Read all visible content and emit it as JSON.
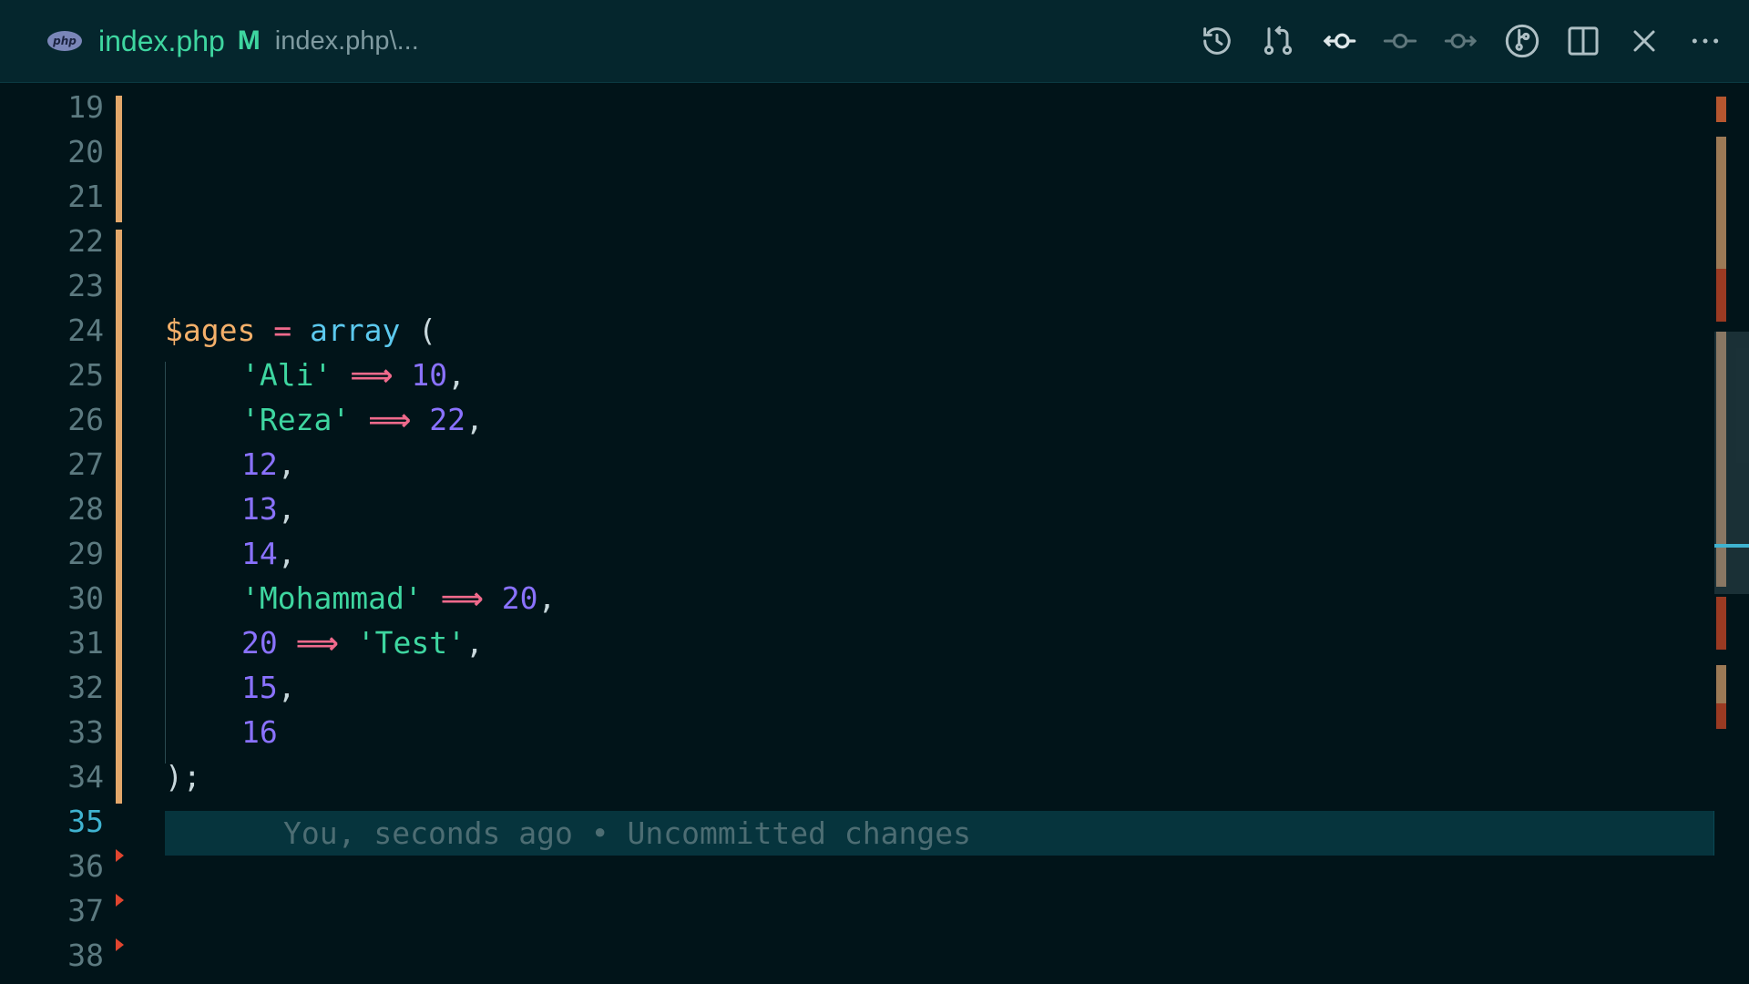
{
  "tab": {
    "language_badge": "php",
    "file_name": "index.php",
    "git_status": "M",
    "description": "index.php\\..."
  },
  "toolbar": {
    "icons": [
      "history-icon",
      "compare-changes-icon",
      "previous-revision-icon",
      "current-revision-icon",
      "next-revision-icon",
      "git-graph-icon",
      "split-editor-icon",
      "close-icon",
      "more-actions-icon"
    ]
  },
  "editor": {
    "active_line": "35",
    "lines": [
      {
        "n": "19"
      },
      {
        "n": "20"
      },
      {
        "n": "21"
      },
      {
        "n": "22"
      },
      {
        "n": "23"
      },
      {
        "n": "24",
        "tokens": [
          [
            "var",
            "$ages"
          ],
          [
            "pun",
            " "
          ],
          [
            "op",
            "="
          ],
          [
            "pun",
            " "
          ],
          [
            "fn",
            "array"
          ],
          [
            "pun",
            " ("
          ]
        ]
      },
      {
        "n": "25",
        "indent": 1,
        "tokens": [
          [
            "str",
            "'Ali'"
          ],
          [
            "pun",
            " "
          ],
          [
            "arrow",
            "⟹"
          ],
          [
            "pun",
            " "
          ],
          [
            "num",
            "10"
          ],
          [
            "pun",
            ","
          ]
        ]
      },
      {
        "n": "26",
        "indent": 1,
        "tokens": [
          [
            "str",
            "'Reza'"
          ],
          [
            "pun",
            " "
          ],
          [
            "arrow",
            "⟹"
          ],
          [
            "pun",
            " "
          ],
          [
            "num",
            "22"
          ],
          [
            "pun",
            ","
          ]
        ]
      },
      {
        "n": "27",
        "indent": 1,
        "tokens": [
          [
            "num",
            "12"
          ],
          [
            "pun",
            ","
          ]
        ]
      },
      {
        "n": "28",
        "indent": 1,
        "tokens": [
          [
            "num",
            "13"
          ],
          [
            "pun",
            ","
          ]
        ]
      },
      {
        "n": "29",
        "indent": 1,
        "tokens": [
          [
            "num",
            "14"
          ],
          [
            "pun",
            ","
          ]
        ]
      },
      {
        "n": "30",
        "indent": 1,
        "tokens": [
          [
            "str",
            "'Mohammad'"
          ],
          [
            "pun",
            " "
          ],
          [
            "arrow",
            "⟹"
          ],
          [
            "pun",
            " "
          ],
          [
            "num",
            "20"
          ],
          [
            "pun",
            ","
          ]
        ]
      },
      {
        "n": "31",
        "indent": 1,
        "tokens": [
          [
            "num",
            "20"
          ],
          [
            "pun",
            " "
          ],
          [
            "arrow",
            "⟹"
          ],
          [
            "pun",
            " "
          ],
          [
            "str",
            "'Test'"
          ],
          [
            "pun",
            ","
          ]
        ]
      },
      {
        "n": "32",
        "indent": 1,
        "tokens": [
          [
            "num",
            "15"
          ],
          [
            "pun",
            ","
          ]
        ]
      },
      {
        "n": "33",
        "indent": 1,
        "tokens": [
          [
            "num",
            "16"
          ]
        ]
      },
      {
        "n": "34",
        "tokens": [
          [
            "pun",
            ");"
          ]
        ]
      },
      {
        "n": "35"
      },
      {
        "n": "36"
      },
      {
        "n": "37"
      },
      {
        "n": "38"
      }
    ],
    "blame": "You, seconds ago • Uncommitted changes"
  },
  "colors": {
    "background": "#011419",
    "titlebar": "#05262d",
    "modified_gutter": "#e3a76a",
    "deleted_marker": "#e0452f",
    "string": "#3ed6a0",
    "number": "#8a72ff",
    "variable": "#f4b06a",
    "function": "#5cc9ee",
    "operator": "#f06a8c"
  }
}
